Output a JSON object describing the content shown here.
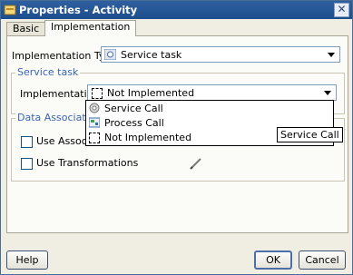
{
  "window": {
    "title": "Properties - Activity"
  },
  "tabs": [
    {
      "label": "Basic"
    },
    {
      "label": "Implementation"
    }
  ],
  "form": {
    "implementation_type_label": "Implementation Type:",
    "implementation_type_value": "Service task",
    "service_task_group": "Service task",
    "implementation_label": "Implementation:",
    "implementation_value": "Not Implemented"
  },
  "dropdown": {
    "options": [
      {
        "label": "Service Call"
      },
      {
        "label": "Process Call"
      },
      {
        "label": "Not Implemented"
      }
    ],
    "tooltip": "Service Call"
  },
  "data_associations": {
    "group_label": "Data Associations",
    "use_associations_label": "Use Associations",
    "use_associations_visible": "Use Associatio",
    "use_transformations_label": "Use Transformations"
  },
  "buttons": {
    "help": "Help",
    "ok": "OK",
    "cancel": "Cancel"
  }
}
